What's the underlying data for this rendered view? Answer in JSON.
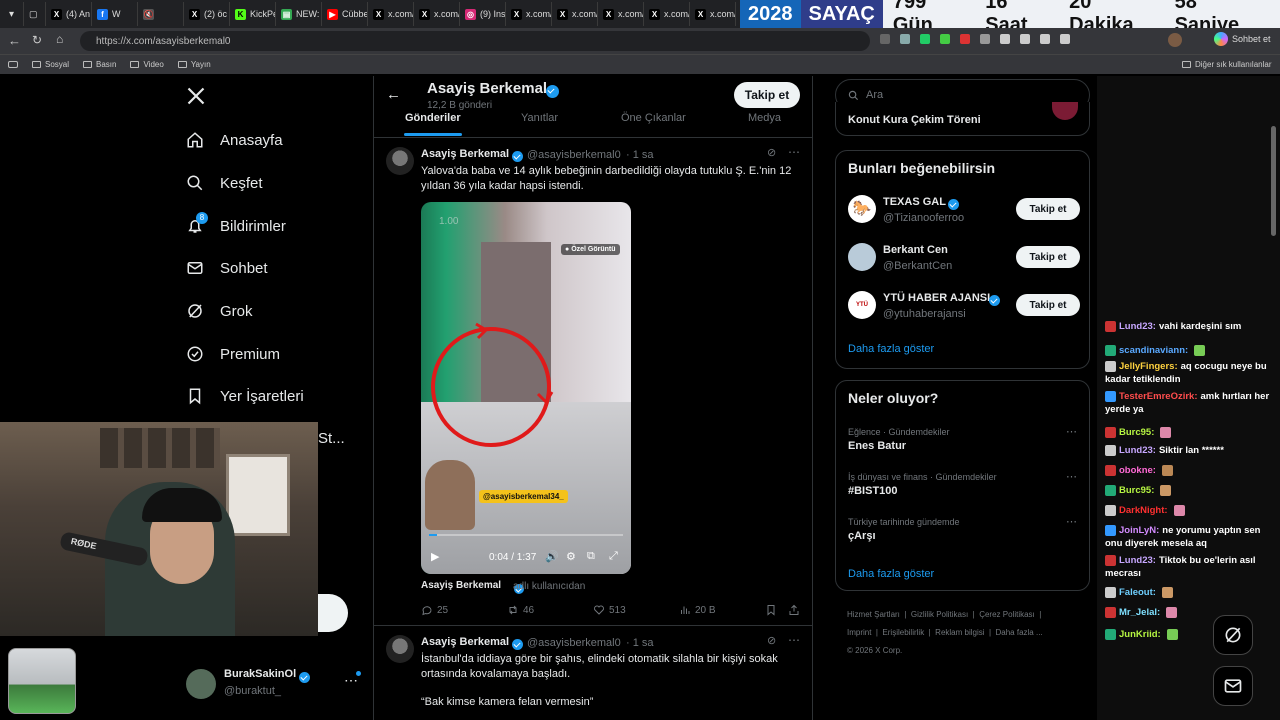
{
  "browser": {
    "tabs": [
      {
        "label": "(4) An",
        "icon": "x-logo-icon"
      },
      {
        "label": "W",
        "icon": "facebook-icon"
      },
      {
        "label": "",
        "icon": "mute-icon"
      },
      {
        "label": "(2) öc",
        "icon": "x-logo-icon"
      },
      {
        "label": "KickPe",
        "icon": "kick-icon"
      },
      {
        "label": "NEW:",
        "icon": "doc-icon"
      },
      {
        "label": "Cübbe",
        "icon": "youtube-icon"
      },
      {
        "label": "x.com/",
        "icon": "x-logo-icon"
      },
      {
        "label": "x.com/",
        "icon": "x-logo-icon"
      },
      {
        "label": "(9) Ins",
        "icon": "instagram-icon"
      },
      {
        "label": "x.com/",
        "icon": "x-logo-icon"
      },
      {
        "label": "x.com/",
        "icon": "x-logo-icon"
      },
      {
        "label": "x.com/",
        "icon": "x-logo-icon"
      },
      {
        "label": "x.com/",
        "icon": "x-logo-icon"
      },
      {
        "label": "x.com/",
        "icon": "x-logo-icon"
      },
      {
        "label": "x.com/",
        "icon": "x-logo-icon"
      }
    ],
    "url": "https://x.com/asayisberkemal0",
    "sidebar_button": "Sohbet et",
    "bookmarks": [
      "Sosyal",
      "Basın",
      "Video",
      "Yayın"
    ],
    "other_bookmarks": "Diğer sık kullanılanlar"
  },
  "counter": {
    "year": "2028",
    "label": "SAYAÇ",
    "days": "799 Gün",
    "hours": "16 Saat",
    "minutes": "20 Dakika",
    "seconds": "58 Saniye"
  },
  "nav": {
    "items": [
      {
        "label": "Anasayfa",
        "icon": "home-icon"
      },
      {
        "label": "Keşfet",
        "icon": "search-icon"
      },
      {
        "label": "Bildirimler",
        "icon": "bell-icon",
        "badge": "8"
      },
      {
        "label": "Sohbet",
        "icon": "mail-icon"
      },
      {
        "label": "Grok",
        "icon": "grok-icon"
      },
      {
        "label": "Premium",
        "icon": "premium-icon"
      },
      {
        "label": "Yer İşaretleri",
        "icon": "bookmark-icon"
      }
    ],
    "partial_item": "St...",
    "user": {
      "name": "BurakSakinOl",
      "handle": "@buraktut_"
    }
  },
  "profile": {
    "name": "Asayiş Berkemal",
    "posts_count": "12,2 B gönderi",
    "follow_label": "Takip et",
    "tabs": [
      "Gönderiler",
      "Yanıtlar",
      "Öne Çıkanlar",
      "Medya"
    ]
  },
  "tweets": [
    {
      "name": "Asayiş Berkemal",
      "handle": "@asayisberkemal0",
      "time": "· 1 sa",
      "text": "Yalova'da baba ve 14 aylık bebeğinin darbedildiği olayda tutuklu Ş. E.'nin 12 yıldan 36 yıla kadar hapsi istendi.",
      "video": {
        "badge": "Özel Görüntü",
        "overlay_handle": "@asayisberkemal34_",
        "time": "0:04 / 1:37",
        "speed": "1.00",
        "progress": 0.04
      },
      "attribution": {
        "name": "Asayiş Berkemal",
        "suffix": "adlı kullanıcıdan"
      },
      "stats": {
        "replies": "25",
        "reposts": "46",
        "likes": "513",
        "views": "20 B"
      }
    },
    {
      "name": "Asayiş Berkemal",
      "handle": "@asayisberkemal0",
      "time": "· 1 sa",
      "text": "İstanbul'da iddiaya göre bir şahıs, elindeki otomatik silahla bir kişiyi sokak ortasında kovalamaya başladı.",
      "quote": "“Bak kimse kamera felan vermesin”"
    }
  ],
  "search": {
    "placeholder": "Ara"
  },
  "sidebar": {
    "event_title": "Konut Kura Çekim Töreni",
    "suggest_title": "Bunları beğenebilirsin",
    "suggestions": [
      {
        "name": "TEXAS GAL",
        "handle": "@Tizianooferroo",
        "verified": true,
        "follow": "Takip et"
      },
      {
        "name": "Berkant Cen",
        "handle": "@BerkantCen",
        "verified": false,
        "follow": "Takip et"
      },
      {
        "name": "YTÜ HABER AJANSI",
        "handle": "@ytuhaberajansi",
        "verified": true,
        "follow": "Takip et"
      }
    ],
    "show_more": "Daha fazla göster",
    "trends_title": "Neler oluyor?",
    "trends": [
      {
        "context": "Eğlence · Gündemdekiler",
        "topic": "Enes Batur"
      },
      {
        "context": "İş dünyası ve finans · Gündemdekiler",
        "topic": "#BIST100"
      },
      {
        "context": "Türkiye tarihinde gündemde",
        "topic": "çArşı"
      }
    ],
    "trends_more": "Daha fazla göster",
    "footer": [
      "Hizmet Şartları",
      "Gizlilik Politikası",
      "Çerez Politikası",
      "Imprint",
      "Erişilebilirlik",
      "Reklam bilgisi",
      "Daha fazla ...",
      "© 2026 X Corp."
    ]
  },
  "chat": [
    {
      "user": "Lund23:",
      "msg": "vahi kardeşini sım",
      "color": "#c7a7ff"
    },
    {
      "user": "scandinaviann:",
      "msg": "",
      "color": "#5aa9ff"
    },
    {
      "user": "JellyFingers:",
      "msg": "aq cocugu neye bu kadar tetiklendin",
      "color": "#ffd23f"
    },
    {
      "user": "TesterEmreOzirk:",
      "msg": "amk hırtları her yerde ya",
      "color": "#ff4d4d"
    },
    {
      "user": "Burc95:",
      "msg": "",
      "color": "#b6f542"
    },
    {
      "user": "Lund23:",
      "msg": "Siktir lan ******",
      "color": "#c7a7ff"
    },
    {
      "user": "obokne:",
      "msg": "",
      "color": "#ff6ad5"
    },
    {
      "user": "Burc95:",
      "msg": "",
      "color": "#b6f542"
    },
    {
      "user": "DarkNight:",
      "msg": "",
      "color": "#ff3030"
    },
    {
      "user": "JoinLyN:",
      "msg": "ne yorumu yaptın sen onu diyerek mesela aq",
      "color": "#d38cff"
    },
    {
      "user": "Lund23:",
      "msg": "Tiktok bu oe'lerin asıl mecrası",
      "color": "#c7a7ff"
    },
    {
      "user": "Faleout:",
      "msg": "",
      "color": "#6fd0ff"
    },
    {
      "user": "Mr_Jelal:",
      "msg": "",
      "color": "#7fe0ff"
    },
    {
      "user": "JunKriid:",
      "msg": "",
      "color": "#b6f542"
    }
  ],
  "colors": {
    "x_blue": "#1d9bf0",
    "bg": "#000000",
    "border": "#2f3336",
    "muted": "#71767b"
  }
}
